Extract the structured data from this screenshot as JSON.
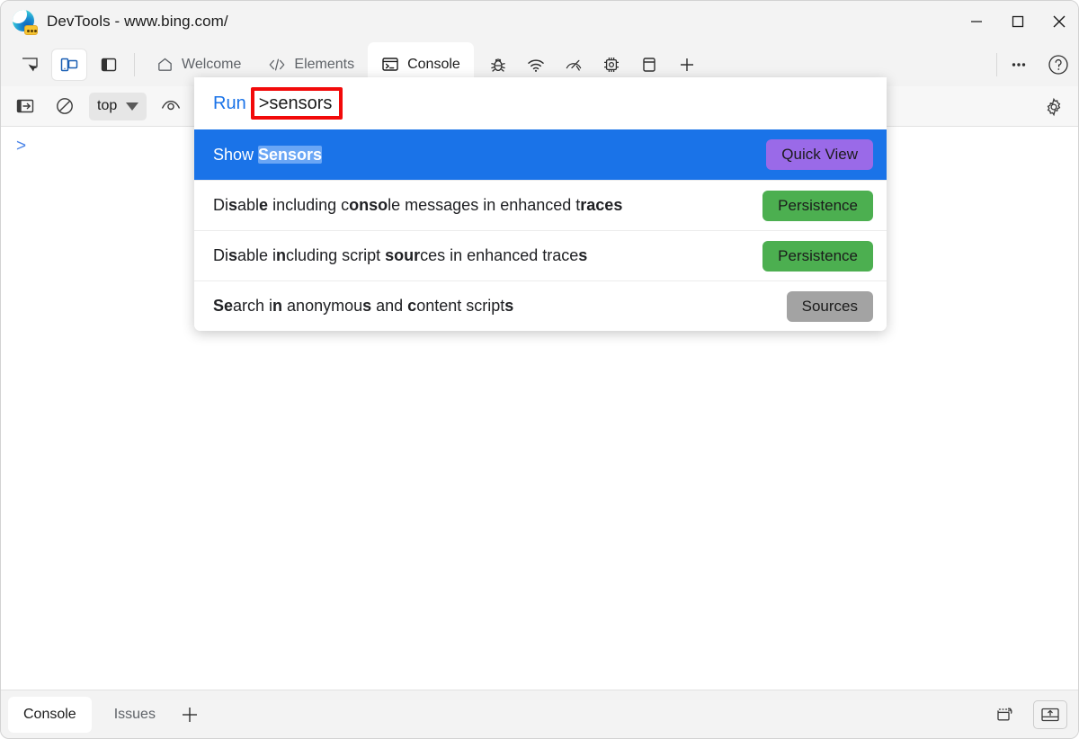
{
  "window": {
    "title": "DevTools - www.bing.com/",
    "logo_icon": "edge-devtools-icon",
    "controls": [
      {
        "name": "minimize",
        "icon": "minimize-icon"
      },
      {
        "name": "maximize",
        "icon": "maximize-icon"
      },
      {
        "name": "close",
        "icon": "close-icon"
      }
    ]
  },
  "toolbar_left": [
    {
      "name": "inspect-element",
      "icon": "inspect-cursor-icon",
      "active": false
    },
    {
      "name": "device-emulation",
      "icon": "device-toolbar-icon",
      "active": true
    },
    {
      "name": "dock-side",
      "icon": "panel-layout-icon",
      "active": false
    }
  ],
  "tabs": [
    {
      "label": "Welcome",
      "icon": "home-icon",
      "active": false
    },
    {
      "label": "Elements",
      "icon": "code-brackets-icon",
      "active": false
    },
    {
      "label": "Console",
      "icon": "console-prompt-icon",
      "active": true
    }
  ],
  "icon_tabs": [
    {
      "name": "sources",
      "icon": "bug-icon"
    },
    {
      "name": "network",
      "icon": "wifi-icon"
    },
    {
      "name": "performance",
      "icon": "gauge-icon"
    },
    {
      "name": "memory",
      "icon": "memory-chip-icon"
    },
    {
      "name": "application",
      "icon": "application-panel-icon"
    },
    {
      "name": "more-tools",
      "icon": "plus-icon"
    }
  ],
  "tabstrip_right": [
    {
      "name": "more-options",
      "icon": "ellipsis-icon"
    },
    {
      "name": "help",
      "icon": "question-circle-icon"
    }
  ],
  "console_toolbar": {
    "sidebar_toggle_icon": "sidebar-toggle-icon",
    "clear_console_icon": "clear-console-icon",
    "context": {
      "value": "top",
      "caret_icon": "chevron-down-icon"
    },
    "eye_icon": "eye-icon",
    "settings_icon": "gear-icon"
  },
  "console": {
    "prompt_symbol": ">"
  },
  "palette": {
    "run_label": "Run",
    "query_prefix": ">",
    "query_value": "sensors",
    "query_full": ">sensors",
    "items": [
      {
        "text_before": "Show ",
        "match": "Sensors",
        "text_after": "",
        "badge": "Quick View",
        "badge_style": "quickview",
        "selected": true
      },
      {
        "segments": [
          {
            "t": "Di",
            "b": false
          },
          {
            "t": "s",
            "b": true
          },
          {
            "t": "abl",
            "b": false
          },
          {
            "t": "e",
            "b": true
          },
          {
            "t": " including c",
            "b": false
          },
          {
            "t": "o",
            "b": true
          },
          {
            "t": "",
            "b": false
          },
          {
            "t": "nso",
            "b": true
          },
          {
            "t": "l",
            "b": false
          },
          {
            "t": "e messages in enhanced t",
            "b": false
          },
          {
            "t": "race",
            "b": false
          },
          {
            "t": "s",
            "b": true
          }
        ],
        "plain": "Disable including console messages in enhanced traces",
        "badge": "Persistence",
        "badge_style": "persistence",
        "selected": false
      },
      {
        "segments": [
          {
            "t": "Di",
            "b": false
          },
          {
            "t": "s",
            "b": true
          },
          {
            "t": "able i",
            "b": false
          },
          {
            "t": "n",
            "b": true
          },
          {
            "t": "cluding script ",
            "b": false
          },
          {
            "t": "sour",
            "b": true
          },
          {
            "t": "ces in enhanced trace",
            "b": false
          },
          {
            "t": "s",
            "b": true
          }
        ],
        "plain": "Disable including script sources in enhanced traces",
        "badge": "Persistence",
        "badge_style": "persistence",
        "selected": false
      },
      {
        "segments": [
          {
            "t": "Se",
            "b": true
          },
          {
            "t": "arch i",
            "b": false
          },
          {
            "t": "n",
            "b": true
          },
          {
            "t": " anonymou",
            "b": false
          },
          {
            "t": "s",
            "b": true
          },
          {
            "t": " and ",
            "b": false
          },
          {
            "t": "c",
            "b": true
          },
          {
            "t": "ontent script",
            "b": false
          },
          {
            "t": "s",
            "b": true
          }
        ],
        "plain": "Search in anonymous and content scripts",
        "badge": "Sources",
        "badge_style": "sources",
        "selected": false
      }
    ]
  },
  "annotation": {
    "shape": "rectangle",
    "color": "#f20a0a",
    "target": "command-palette-query-input"
  },
  "drawer": {
    "tabs": [
      {
        "label": "Console",
        "active": true
      },
      {
        "label": "Issues",
        "active": false
      }
    ],
    "add_icon": "plus-icon",
    "right_icons": [
      {
        "name": "restore-drawer",
        "icon": "restore-drawer-icon"
      },
      {
        "name": "dock-panel-up",
        "icon": "dock-panel-up-icon"
      }
    ]
  },
  "colors": {
    "selection_blue": "#1a73e8",
    "match_highlight": "#6aa6f5",
    "badge_quickview": "#9a6ae8",
    "badge_persistence": "#4caf50",
    "badge_sources": "#a3a3a3",
    "annotation_red": "#f20a0a",
    "link_blue": "#1a73e8",
    "chrome_bg": "#f3f3f3"
  }
}
